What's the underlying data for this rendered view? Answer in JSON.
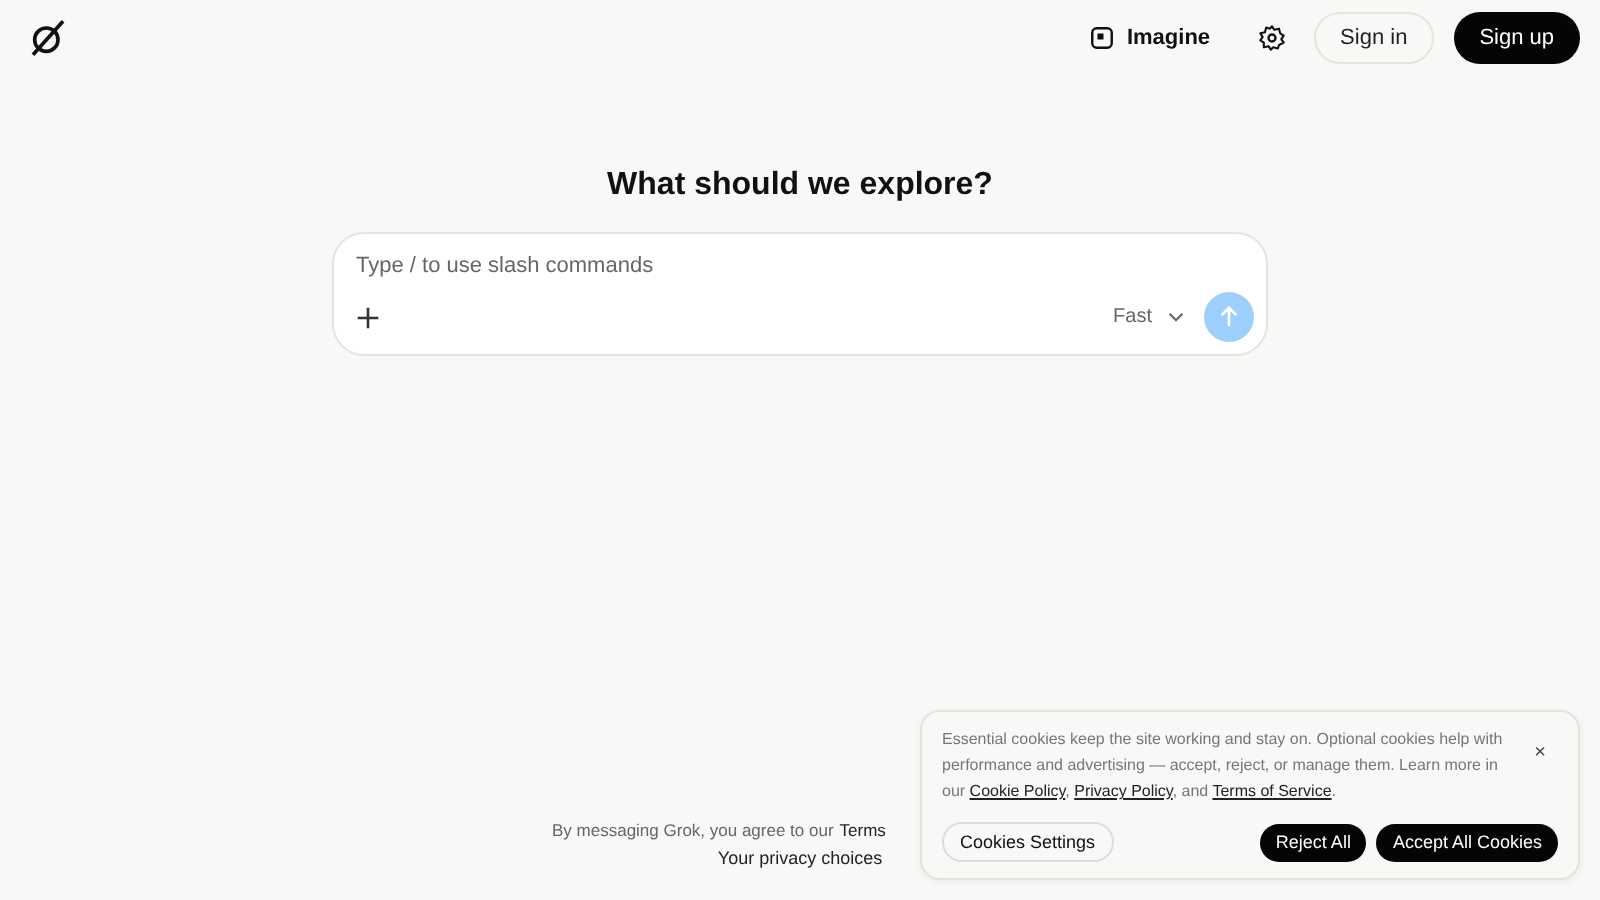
{
  "header": {
    "nav": [
      {
        "kind": "imagine",
        "label": "Imagine"
      },
      {
        "kind": "settings"
      }
    ],
    "sign_in": "Sign in",
    "sign_up": "Sign up"
  },
  "heading": "What should we explore?",
  "composer": {
    "placeholder": "Type / to use slash commands",
    "model": "Fast",
    "send_disabled": true
  },
  "footer": {
    "text": "By messaging Grok, you agree to our",
    "link": "Terms",
    "privacy": "Your privacy choices"
  },
  "cookie_banner": {
    "parts": [
      {
        "kind": "text",
        "text": "Essential cookies keep the site working and stay on. Optional cookies help with performance and advertising — accept, reject, or manage them. Learn more in our "
      },
      {
        "kind": "link",
        "text": "Cookie Policy"
      },
      {
        "kind": "text",
        "text": ", "
      },
      {
        "kind": "link",
        "text": "Privacy Policy"
      },
      {
        "kind": "text",
        "text": ", and "
      },
      {
        "kind": "link",
        "text": "Terms of Service"
      },
      {
        "kind": "text",
        "text": "."
      }
    ],
    "close": "×",
    "settings": "Cookies Settings",
    "reject": "Reject All",
    "accept": "Accept All Cookies"
  }
}
